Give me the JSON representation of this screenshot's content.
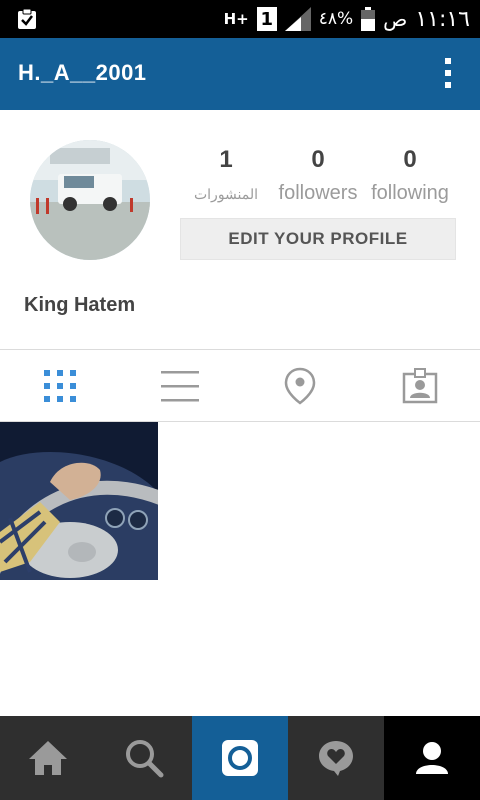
{
  "status_bar": {
    "time": "١١:١٦",
    "ampm": "ص",
    "battery": "٤٨%",
    "network": "H+",
    "sim": "1",
    "icons": [
      "clipboard-check-icon",
      "signal-icon",
      "battery-icon"
    ]
  },
  "header": {
    "username": "H._A__2001",
    "menu_icon": "more-vertical-icon"
  },
  "profile": {
    "full_name": "King Hatem",
    "stats": [
      {
        "value": "1",
        "label": "المنشورات"
      },
      {
        "value": "0",
        "label": "followers"
      },
      {
        "value": "0",
        "label": "following"
      }
    ],
    "edit_button": "EDIT YOUR PROFILE"
  },
  "tabs": [
    {
      "icon": "grid-icon",
      "active": true
    },
    {
      "icon": "list-icon",
      "active": false
    },
    {
      "icon": "location-pin-icon",
      "active": false
    },
    {
      "icon": "tagged-person-icon",
      "active": false
    }
  ],
  "bottom_nav": [
    {
      "icon": "home-icon",
      "active": false
    },
    {
      "icon": "search-icon",
      "active": false
    },
    {
      "icon": "camera-icon",
      "active": false
    },
    {
      "icon": "activity-heart-icon",
      "active": false
    },
    {
      "icon": "profile-icon",
      "active": true
    }
  ],
  "colors": {
    "header": "#145f97",
    "accent": "#3b8ed8",
    "bottom_nav": "#2f2f2f",
    "camera_button": "#145f97",
    "active_profile": "#000000"
  }
}
